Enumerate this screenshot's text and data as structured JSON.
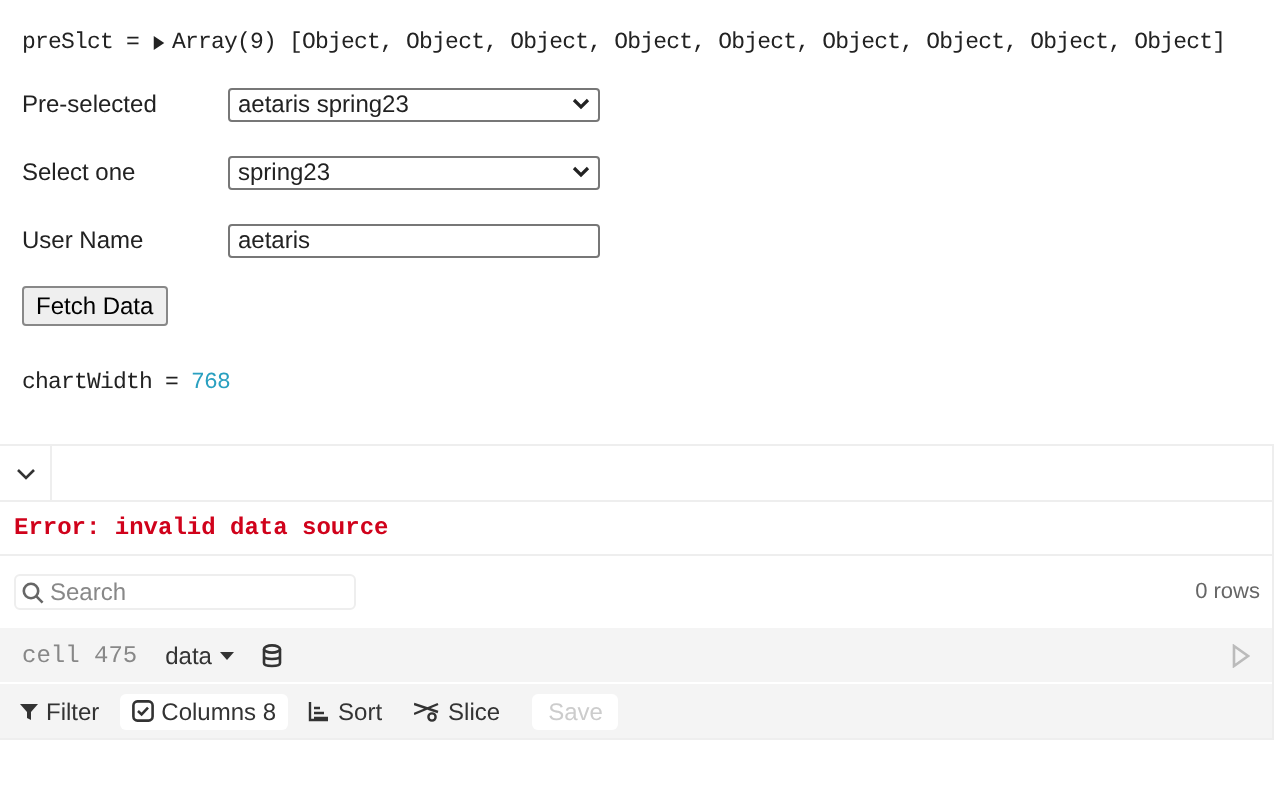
{
  "inspector": {
    "name": "preSlct",
    "operator": "=",
    "summary": "Array(9)",
    "contents": "[Object, Object, Object, Object, Object, Object, Object, Object, Object]",
    "expanded": false
  },
  "form": [
    {
      "kind": "select",
      "label": "Pre-selected",
      "value": "aetaris spring23"
    },
    {
      "kind": "select",
      "label": "Select one",
      "value": "spring23"
    },
    {
      "kind": "text",
      "label": "User Name",
      "value": "aetaris"
    }
  ],
  "fetch_button": "Fetch Data",
  "chart_width": {
    "name": "chartWidth",
    "operator": "=",
    "value": "768"
  },
  "table_cell": {
    "collapsed": false,
    "error": "Error: invalid data source",
    "search": {
      "placeholder": "Search"
    },
    "row_count": "0 rows",
    "footer": {
      "cell_label": "cell 475",
      "source": "data"
    },
    "toolbar": [
      {
        "kind": "filter",
        "label": "Filter",
        "disabled": false
      },
      {
        "kind": "columns",
        "label": "Columns 8",
        "disabled": false
      },
      {
        "kind": "sort",
        "label": "Sort",
        "disabled": false
      },
      {
        "kind": "slice",
        "label": "Slice",
        "disabled": false
      },
      {
        "kind": "save",
        "label": "Save",
        "disabled": true
      }
    ]
  }
}
